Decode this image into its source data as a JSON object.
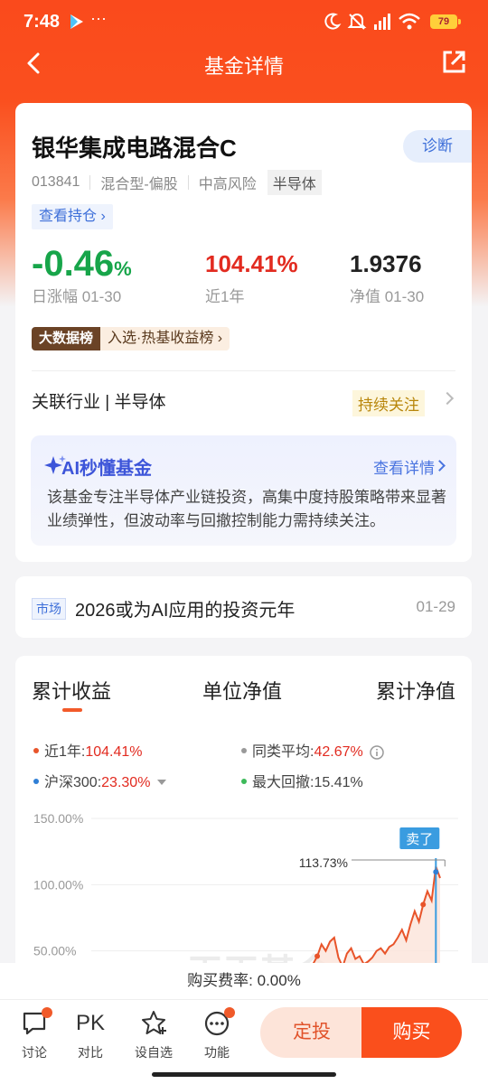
{
  "status_bar": {
    "time": "7:48",
    "battery": "79"
  },
  "nav": {
    "title": "基金详情"
  },
  "fund": {
    "name": "银华集成电路混合C",
    "diagnose_label": "诊断",
    "code": "013841",
    "type": "混合型-偏股",
    "risk": "中高风险",
    "sector_tag": "半导体",
    "holdings_link": "查看持仓 ›"
  },
  "stats": {
    "daily_change": "-0.46",
    "daily_change_unit": "%",
    "daily_label": "日涨幅 01-30",
    "year_return": "104.41%",
    "year_label": "近1年",
    "nav_value": "1.9376",
    "nav_label": "净值 01-30"
  },
  "ranking": {
    "badge": "大数据榜",
    "text": "入选·热基收益榜 ›"
  },
  "industry": {
    "label": "关联行业 | 半导体",
    "follow": "持续关注"
  },
  "ai": {
    "title": "AI秒懂基金",
    "link": "查看详情",
    "text": "该基金专注半导体产业链投资，高集中度持股策略带来显著业绩弹性，但波动率与回撤控制能力需持续关注。"
  },
  "news": {
    "tag": "市场",
    "headline": "2026或为AI应用的投资元年",
    "date": "01-29"
  },
  "chart_tabs": [
    "累计收益",
    "单位净值",
    "累计净值"
  ],
  "legend": {
    "year_label": "近1年:",
    "year_value": "104.41%",
    "peer_label": "同类平均:",
    "peer_value": "42.67%",
    "hs_label": "沪深300:",
    "hs_value": "23.30%",
    "dd_label": "最大回撤:",
    "dd_value": "15.41%"
  },
  "chart_data": {
    "type": "line",
    "y_ticks": [
      "150.00%",
      "100.00%",
      "50.00%"
    ],
    "ylim": [
      0,
      150
    ],
    "annotation_value": "113.73%",
    "sell_marker": "卖了",
    "series": [
      {
        "name": "近1年",
        "color": "#e8542a",
        "values": [
          28,
          32,
          40,
          46,
          55,
          50,
          57,
          60,
          45,
          38,
          48,
          52,
          44,
          46,
          40,
          42,
          45,
          50,
          52,
          48,
          53,
          55,
          60,
          66,
          58,
          70,
          80,
          72,
          85,
          95,
          88,
          113.73,
          105
        ]
      },
      {
        "name": "同类平均",
        "color": "#b0b0b0",
        "values": [
          0,
          0,
          0,
          0,
          0,
          0,
          0,
          0,
          0,
          0,
          0,
          0,
          0,
          0,
          0,
          0,
          0,
          0,
          0,
          0,
          0,
          0,
          0,
          0,
          0,
          0,
          0,
          0,
          0,
          0,
          2,
          5,
          6
        ]
      }
    ],
    "watermark": "天天基金"
  },
  "fee": {
    "label": "购买费率:",
    "value": "0.00%"
  },
  "bottom_bar": {
    "discuss": "讨论",
    "pk_icon": "PK",
    "compare": "对比",
    "watch": "设自选",
    "func": "功能",
    "fixed_invest": "定投",
    "buy": "购买"
  },
  "colors": {
    "brand": "#fa4f1c",
    "up": "#e22b20",
    "down": "#17a54a",
    "link": "#3d6fd9"
  }
}
